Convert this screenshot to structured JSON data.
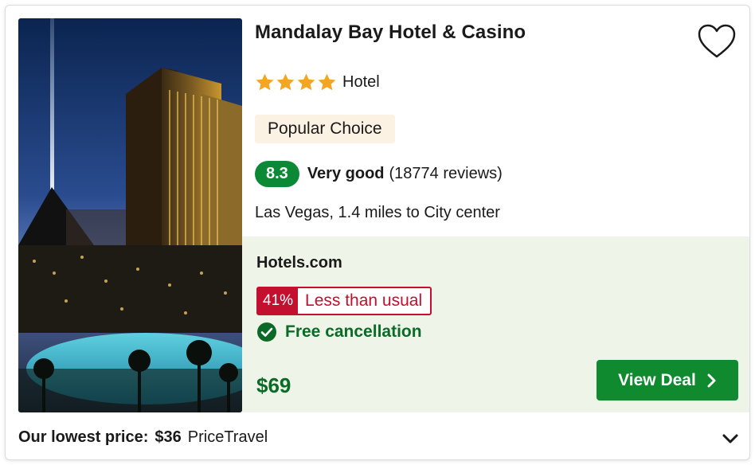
{
  "hotel": {
    "name": "Mandalay Bay Hotel & Casino",
    "star_count": 4,
    "type": "Hotel",
    "badge": "Popular Choice",
    "score": "8.3",
    "score_label": "Very good",
    "reviews": "(18774 reviews)",
    "location": "Las Vegas, 1.4 miles to City center",
    "favorite_icon": "heart-outline-icon"
  },
  "deal": {
    "provider": "Hotels.com",
    "discount_pct": "41%",
    "discount_text": "Less than usual",
    "cancellation": "Free cancellation",
    "price": "$69",
    "button_label": "View Deal",
    "background": "#eef5e8",
    "button_color": "#0f8a2e",
    "discount_color": "#c2102e"
  },
  "lowest": {
    "label": "Our lowest price:",
    "price": "$36",
    "provider": "PriceTravel"
  },
  "colors": {
    "star": "#f5a524",
    "score_bg": "#0c8934",
    "badge_bg": "#fcf2e4"
  }
}
